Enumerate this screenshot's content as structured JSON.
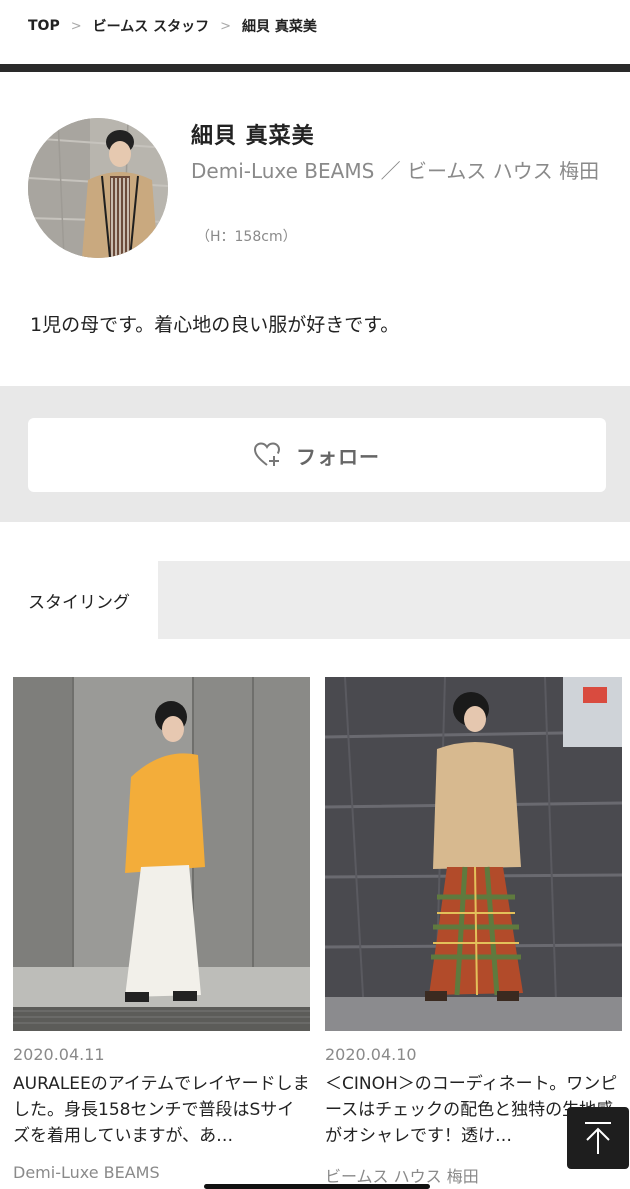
{
  "breadcrumb": {
    "items": [
      "TOP",
      "ビームス スタッフ",
      "細貝 真菜美"
    ],
    "separator": ">"
  },
  "profile": {
    "name": "細貝 真菜美",
    "shop": "Demi-Luxe BEAMS ／ ビームス ハウス 梅田",
    "height": "（H：158cm）",
    "bio": "1児の母です。着心地の良い服が好きです。"
  },
  "follow": {
    "label": "フォロー",
    "icon": "heart-plus-icon"
  },
  "tabs": {
    "active": "スタイリング"
  },
  "posts": [
    {
      "date": "2020.04.11",
      "description": "AURALEEのアイテムでレイヤードしました。身長158センチで普段はSサイズを着用していますが、あ…",
      "store": "Demi-Luxe BEAMS"
    },
    {
      "date": "2020.04.10",
      "description": "＜CINOH＞のコーディネート。ワンピースはチェックの配色と独特の生地感がオシャレです！透け…",
      "store": "ビームス ハウス 梅田"
    }
  ],
  "scroll_top": {
    "icon": "arrow-up-to-top-icon"
  },
  "colors": {
    "text": "#222222",
    "muted": "#8a8a8a",
    "panel": "#e8e8e8",
    "top_bar": "#2a2a2a"
  }
}
